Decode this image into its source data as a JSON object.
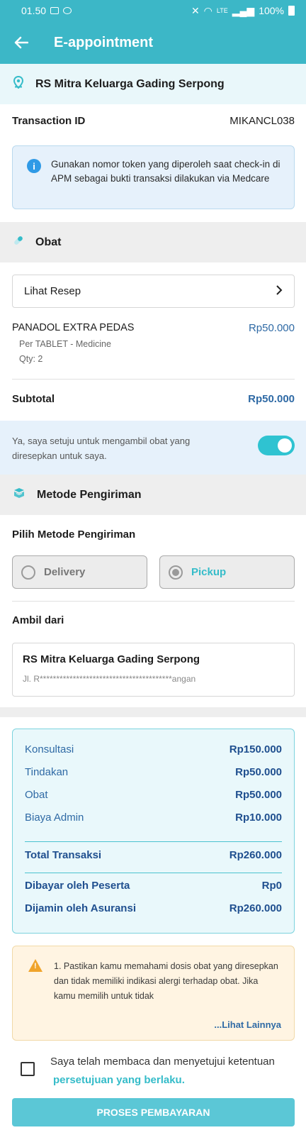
{
  "status_bar": {
    "time": "01.50",
    "battery": "100%",
    "network": "LTE"
  },
  "app_bar": {
    "title": "E-appointment",
    "back_icon": "arrow-left-icon"
  },
  "hospital": {
    "name": "RS Mitra Keluarga Gading Serpong",
    "icon": "location-pin-icon"
  },
  "transaction": {
    "label": "Transaction ID",
    "value": "MIKANCL038"
  },
  "info_notice": {
    "text": "Gunakan nomor token yang diperoleh saat check-in di APM sebagai bukti transaksi dilakukan via Medcare"
  },
  "obat_section": {
    "title": "Obat",
    "icon": "pill-icon",
    "resep_button": "Lihat Resep"
  },
  "medicine": {
    "name": "PANADOL EXTRA PEDAS",
    "price": "Rp50.000",
    "unit": "Per TABLET - Medicine",
    "qty": "Qty: 2"
  },
  "subtotal": {
    "label": "Subtotal",
    "value": "Rp50.000"
  },
  "consent": {
    "text": "Ya, saya setuju untuk mengambil obat yang diresepkan untuk saya.",
    "enabled": true
  },
  "shipping_section": {
    "title": "Metode Pengiriman",
    "icon": "box-icon",
    "choose_label": "Pilih Metode Pengiriman",
    "options": [
      "Delivery",
      "Pickup"
    ],
    "selected": "Pickup"
  },
  "pickup_location": {
    "label": "Ambil dari",
    "name": "RS Mitra Keluarga Gading Serpong",
    "address": "Jl. R****************************************angan"
  },
  "summary": {
    "rows": [
      {
        "label": "Konsultasi",
        "value": "Rp150.000"
      },
      {
        "label": "Tindakan",
        "value": "Rp50.000"
      },
      {
        "label": "Obat",
        "value": "Rp50.000"
      },
      {
        "label": "Biaya Admin",
        "value": "Rp10.000"
      }
    ],
    "total_label": "Total Transaksi",
    "total_value": "Rp260.000",
    "paid_label": "Dibayar oleh Peserta",
    "paid_value": "Rp0",
    "insured_label": "Dijamin oleh Asuransi",
    "insured_value": "Rp260.000"
  },
  "warning": {
    "text": "1. Pastikan kamu memahami dosis obat yang diresepkan dan tidak memiliki indikasi alergi terhadap obat. Jika kamu memilih untuk tidak",
    "more": "...Lihat Lainnya"
  },
  "agreement": {
    "text": "Saya telah membaca dan menyetujui ketentuan",
    "link": "persetujuan yang berlaku."
  },
  "pay_button": "PROSES PEMBAYARAN",
  "colors": {
    "brand": "#3cb7c7",
    "accent_blue": "#2f6aa5",
    "toggle_on": "#2fc3d1"
  }
}
